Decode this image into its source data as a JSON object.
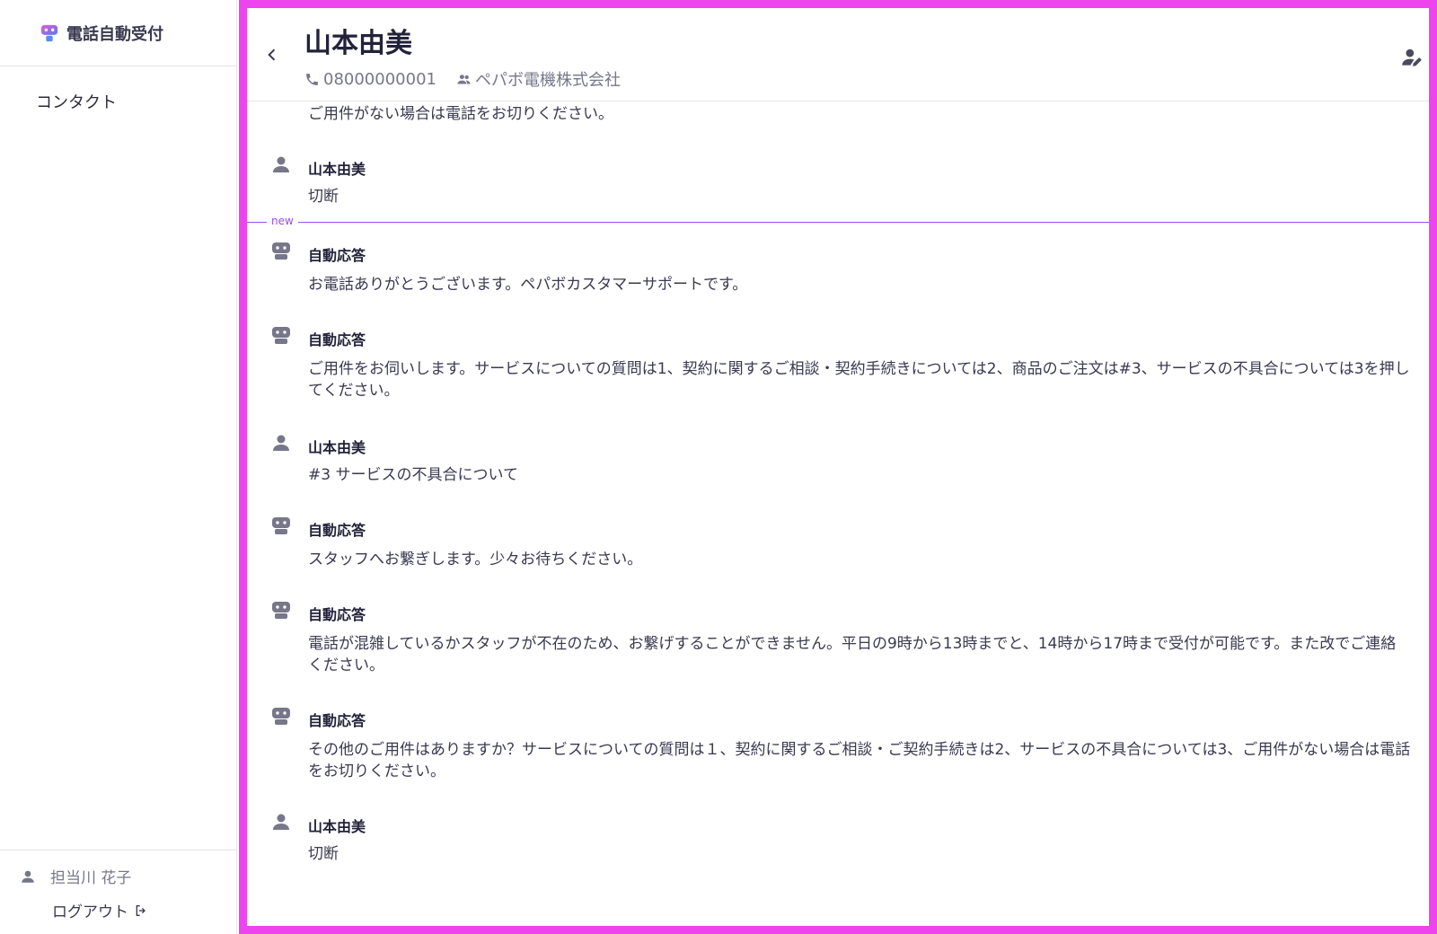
{
  "app": {
    "brand": "電話自動受付",
    "nav": [
      {
        "label": "コンタクト"
      }
    ],
    "agent": {
      "name": "担当川 花子"
    },
    "logout_label": "ログアウト"
  },
  "contact": {
    "name": "山本由美",
    "phone": "08000000001",
    "company": "ペパボ電機株式会社"
  },
  "divider_label": "new",
  "icons": {
    "brand": "robot-logo-icon",
    "user": "person-icon",
    "bot": "robot-icon",
    "back": "chevron-left-icon",
    "phone": "phone-icon",
    "company": "group-icon",
    "edit": "person-edit-icon",
    "logout": "logout-icon"
  },
  "colors": {
    "accent": "#9b4dea",
    "frame": "#ee44ee",
    "muted": "#77778a"
  },
  "messages": [
    {
      "sender": "",
      "type": "bot",
      "text": "ご用件がない場合は電話をお切りください。",
      "partial": true
    },
    {
      "sender": "山本由美",
      "type": "user",
      "text": "切断"
    },
    {
      "sender": "自動応答",
      "type": "bot",
      "text": "お電話ありがとうございます。ペパボカスタマーサポートです。"
    },
    {
      "sender": "自動応答",
      "type": "bot",
      "text": "ご用件をお伺いします。サービスについての質問は1、契約に関するご相談・契約手続きについては2、商品のご注文は#3、サービスの不具合については3を押してください。"
    },
    {
      "sender": "山本由美",
      "type": "user",
      "text": "#3 サービスの不具合について"
    },
    {
      "sender": "自動応答",
      "type": "bot",
      "text": "スタッフへお繋ぎします。少々お待ちください。"
    },
    {
      "sender": "自動応答",
      "type": "bot",
      "text": "電話が混雑しているかスタッフが不在のため、お繋げすることができません。平日の9時から13時までと、14時から17時まで受付が可能です。また改でご連絡ください。"
    },
    {
      "sender": "自動応答",
      "type": "bot",
      "text": "その他のご用件はありますか？サービスについての質問は１、契約に関するご相談・ご契約手続きは2、サービスの不具合については3、ご用件がない場合は電話をお切りください。"
    },
    {
      "sender": "山本由美",
      "type": "user",
      "text": "切断"
    }
  ]
}
